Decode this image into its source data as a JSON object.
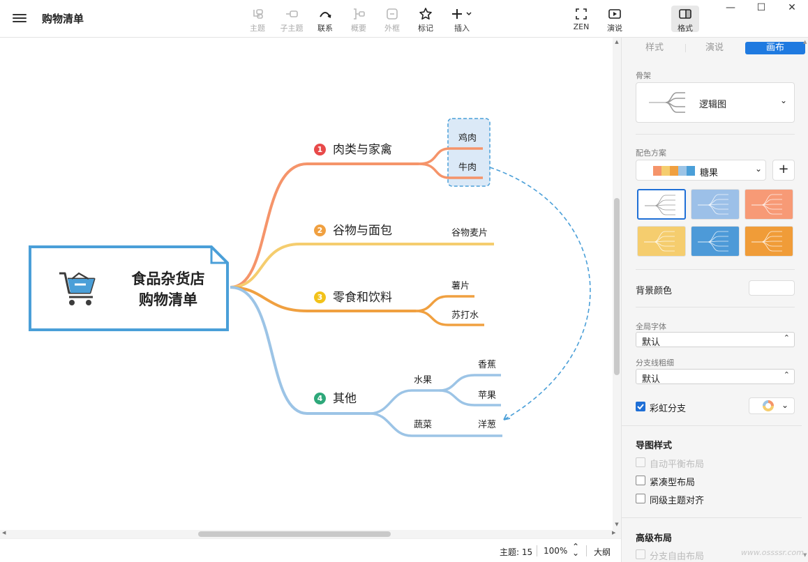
{
  "app": {
    "title": "购物清单"
  },
  "toolbar": {
    "items": [
      {
        "label": "主题",
        "icon": "topic-icon",
        "enabled": false
      },
      {
        "label": "子主题",
        "icon": "subtopic-icon",
        "enabled": false
      },
      {
        "label": "联系",
        "icon": "relationship-icon",
        "enabled": true
      },
      {
        "label": "概要",
        "icon": "summary-icon",
        "enabled": false
      },
      {
        "label": "外框",
        "icon": "boundary-icon",
        "enabled": false
      },
      {
        "label": "标记",
        "icon": "star-icon",
        "enabled": true
      },
      {
        "label": "插入",
        "icon": "plus-icon",
        "enabled": true
      }
    ],
    "right_items": [
      {
        "label": "ZEN",
        "icon": "fullscreen-icon"
      },
      {
        "label": "演说",
        "icon": "present-icon"
      },
      {
        "label": "格式",
        "icon": "format-panel-icon",
        "active": true
      }
    ]
  },
  "window_controls": {
    "minimize": "—",
    "maximize": "☐",
    "close": "✕"
  },
  "mindmap": {
    "central": {
      "line1": "食品杂货店",
      "line2": "购物清单",
      "icon": "shopping-cart-icon"
    },
    "branches": [
      {
        "num": "1",
        "label": "肉类与家禽",
        "color": "#f5946a",
        "badge_color": "#e84a4a",
        "children": [
          "鸡肉",
          "牛肉"
        ]
      },
      {
        "num": "2",
        "label": "谷物与面包",
        "color": "#f5cd6e",
        "badge_color": "#f0a040",
        "children": [
          "谷物麦片"
        ]
      },
      {
        "num": "3",
        "label": "零食和饮料",
        "color": "#f0a040",
        "badge_color": "#f2c21a",
        "children": [
          "薯片",
          "苏打水"
        ]
      },
      {
        "num": "4",
        "label": "其他",
        "color": "#9cc4e6",
        "badge_color": "#2ea87a",
        "groups": [
          {
            "label": "水果",
            "children": [
              "香蕉",
              "苹果"
            ]
          },
          {
            "label": "蔬菜",
            "children": [
              "洋葱"
            ]
          }
        ]
      }
    ],
    "selection_color": "#4a9fd8"
  },
  "status": {
    "topic_count": "主题: 15",
    "zoom": "100%",
    "outline": "大纲"
  },
  "panel": {
    "tabs": [
      "样式",
      "演说",
      "画布"
    ],
    "active_tab": "画布",
    "skeleton_label": "骨架",
    "skeleton_value": "逻辑图",
    "color_scheme_label": "配色方案",
    "color_scheme_value": "糖果",
    "color_scheme_swatches": [
      "#f5946a",
      "#f5cd6e",
      "#f0a040",
      "#9cc4e6",
      "#4a9fd8"
    ],
    "theme_cards": [
      {
        "bg": "#ffffff",
        "selected": true
      },
      {
        "bg": "#9cc0e8",
        "selected": false
      },
      {
        "bg": "#f79a76",
        "selected": false
      },
      {
        "bg": "#f5cd6e",
        "selected": false
      },
      {
        "bg": "#4d9ad8",
        "selected": false
      },
      {
        "bg": "#f09c38",
        "selected": false
      }
    ],
    "bg_color_label": "背景颜色",
    "font_label": "全局字体",
    "font_value": "默认",
    "branch_width_label": "分支线粗细",
    "branch_width_value": "默认",
    "rainbow_label": "彩虹分支",
    "rainbow_checked": true,
    "map_style_label": "导图样式",
    "map_style_options": [
      {
        "label": "自动平衡布局",
        "checked": false,
        "disabled": true
      },
      {
        "label": "紧凑型布局",
        "checked": false,
        "disabled": false
      },
      {
        "label": "同级主题对齐",
        "checked": false,
        "disabled": false
      }
    ],
    "advanced_label": "高级布局",
    "advanced_options": [
      {
        "label": "分支自由布局",
        "checked": false,
        "disabled": true
      }
    ]
  },
  "watermark": "www.ossssr.com"
}
